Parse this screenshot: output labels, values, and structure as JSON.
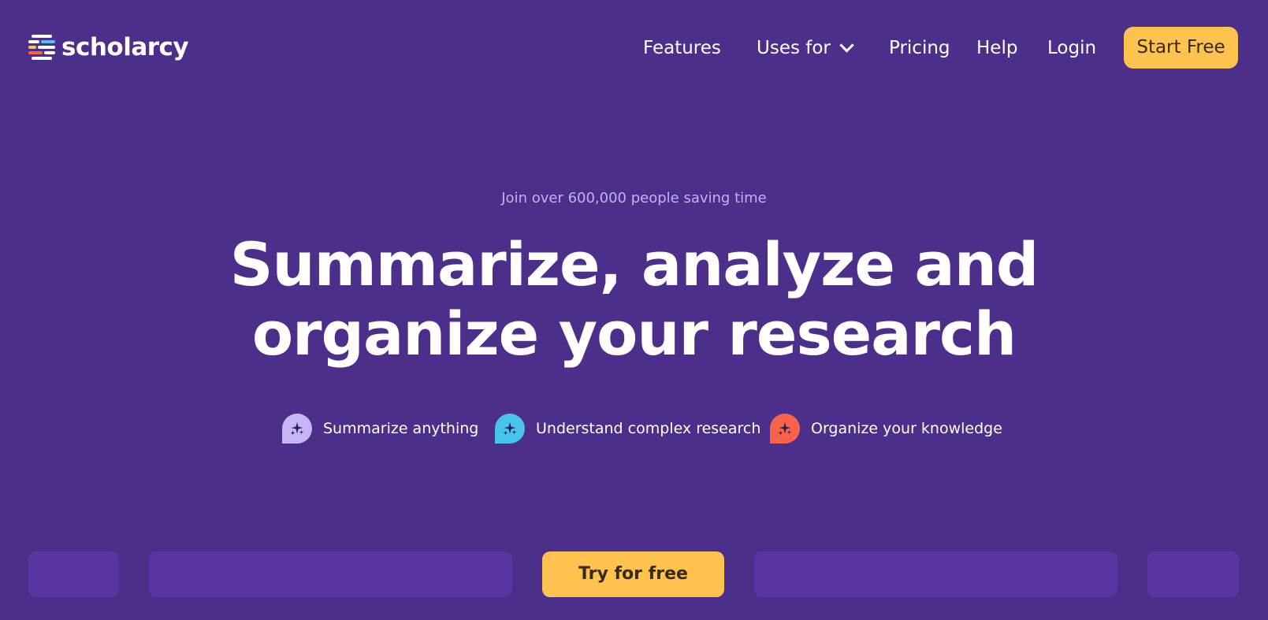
{
  "header": {
    "logo_text": "scholarcy",
    "nav": {
      "features": "Features",
      "uses_for": "Uses for",
      "pricing": "Pricing",
      "help": "Help",
      "login": "Login"
    },
    "cta": "Start Free"
  },
  "hero": {
    "kicker": "Join over 600,000 people saving time",
    "title_line1": "Summarize, analyze and",
    "title_line2": "organize your research",
    "features": [
      {
        "label": "Summarize anything",
        "icon": "sparkle-bubble-icon",
        "color": "#c7b6f5"
      },
      {
        "label": "Understand complex research",
        "icon": "sparkle-bubble-icon",
        "color": "#48c3ee"
      },
      {
        "label": "Organize your knowledge",
        "icon": "sparkle-bubble-icon",
        "color": "#f9634a"
      }
    ]
  },
  "bottom": {
    "cta": "Try for free"
  },
  "colors": {
    "background": "#4c2f8a",
    "accent": "#fdc34e",
    "card": "#5835a0",
    "kicker": "#c2b2ee"
  }
}
